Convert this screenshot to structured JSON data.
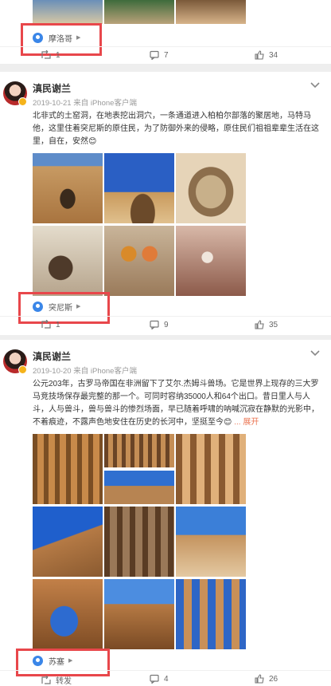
{
  "top_card": {
    "location": "摩洛哥",
    "repost_count": "1",
    "comment_count": "7",
    "like_count": "34"
  },
  "posts": [
    {
      "username": "滇民谢兰",
      "meta": "2019-10-21  来自 iPhone客户端",
      "text": "北非式的土窑洞，在地表挖出洞穴，一条通道进入柏柏尔部落的聚居地，马特马他，这里住着突尼斯的原住民，为了防御外来的侵略，原住民们祖祖辈辈生活在这里，自在，安然😊",
      "location": "突尼斯",
      "repost_count": "1",
      "comment_count": "9",
      "like_count": "35"
    },
    {
      "username": "滇民谢兰",
      "meta": "2019-10-20  来自 iPhone客户端",
      "text": "公元203年，古罗马帝国在非洲留下了艾尔.杰姆斗兽场。它是世界上现存的三大罗马竞技场保存最完整的那一个。可同时容纳35000人和64个出口。昔日里人与人斗，人与兽斗，兽与兽斗的惨烈场面，早已随着呼啸的呐喊沉寂在静默的光影中，不着痕迹，不露声色地安住在历史的长河中，坚挺至今😊",
      "more_label": "... 展开",
      "location": "苏塞",
      "repost_label": "转发",
      "comment_count": "4",
      "like_count": "26"
    }
  ],
  "colors": {
    "highlight_box": "#e8474b",
    "location_pin": "#3a86e8",
    "expand_link": "#eb7350"
  }
}
